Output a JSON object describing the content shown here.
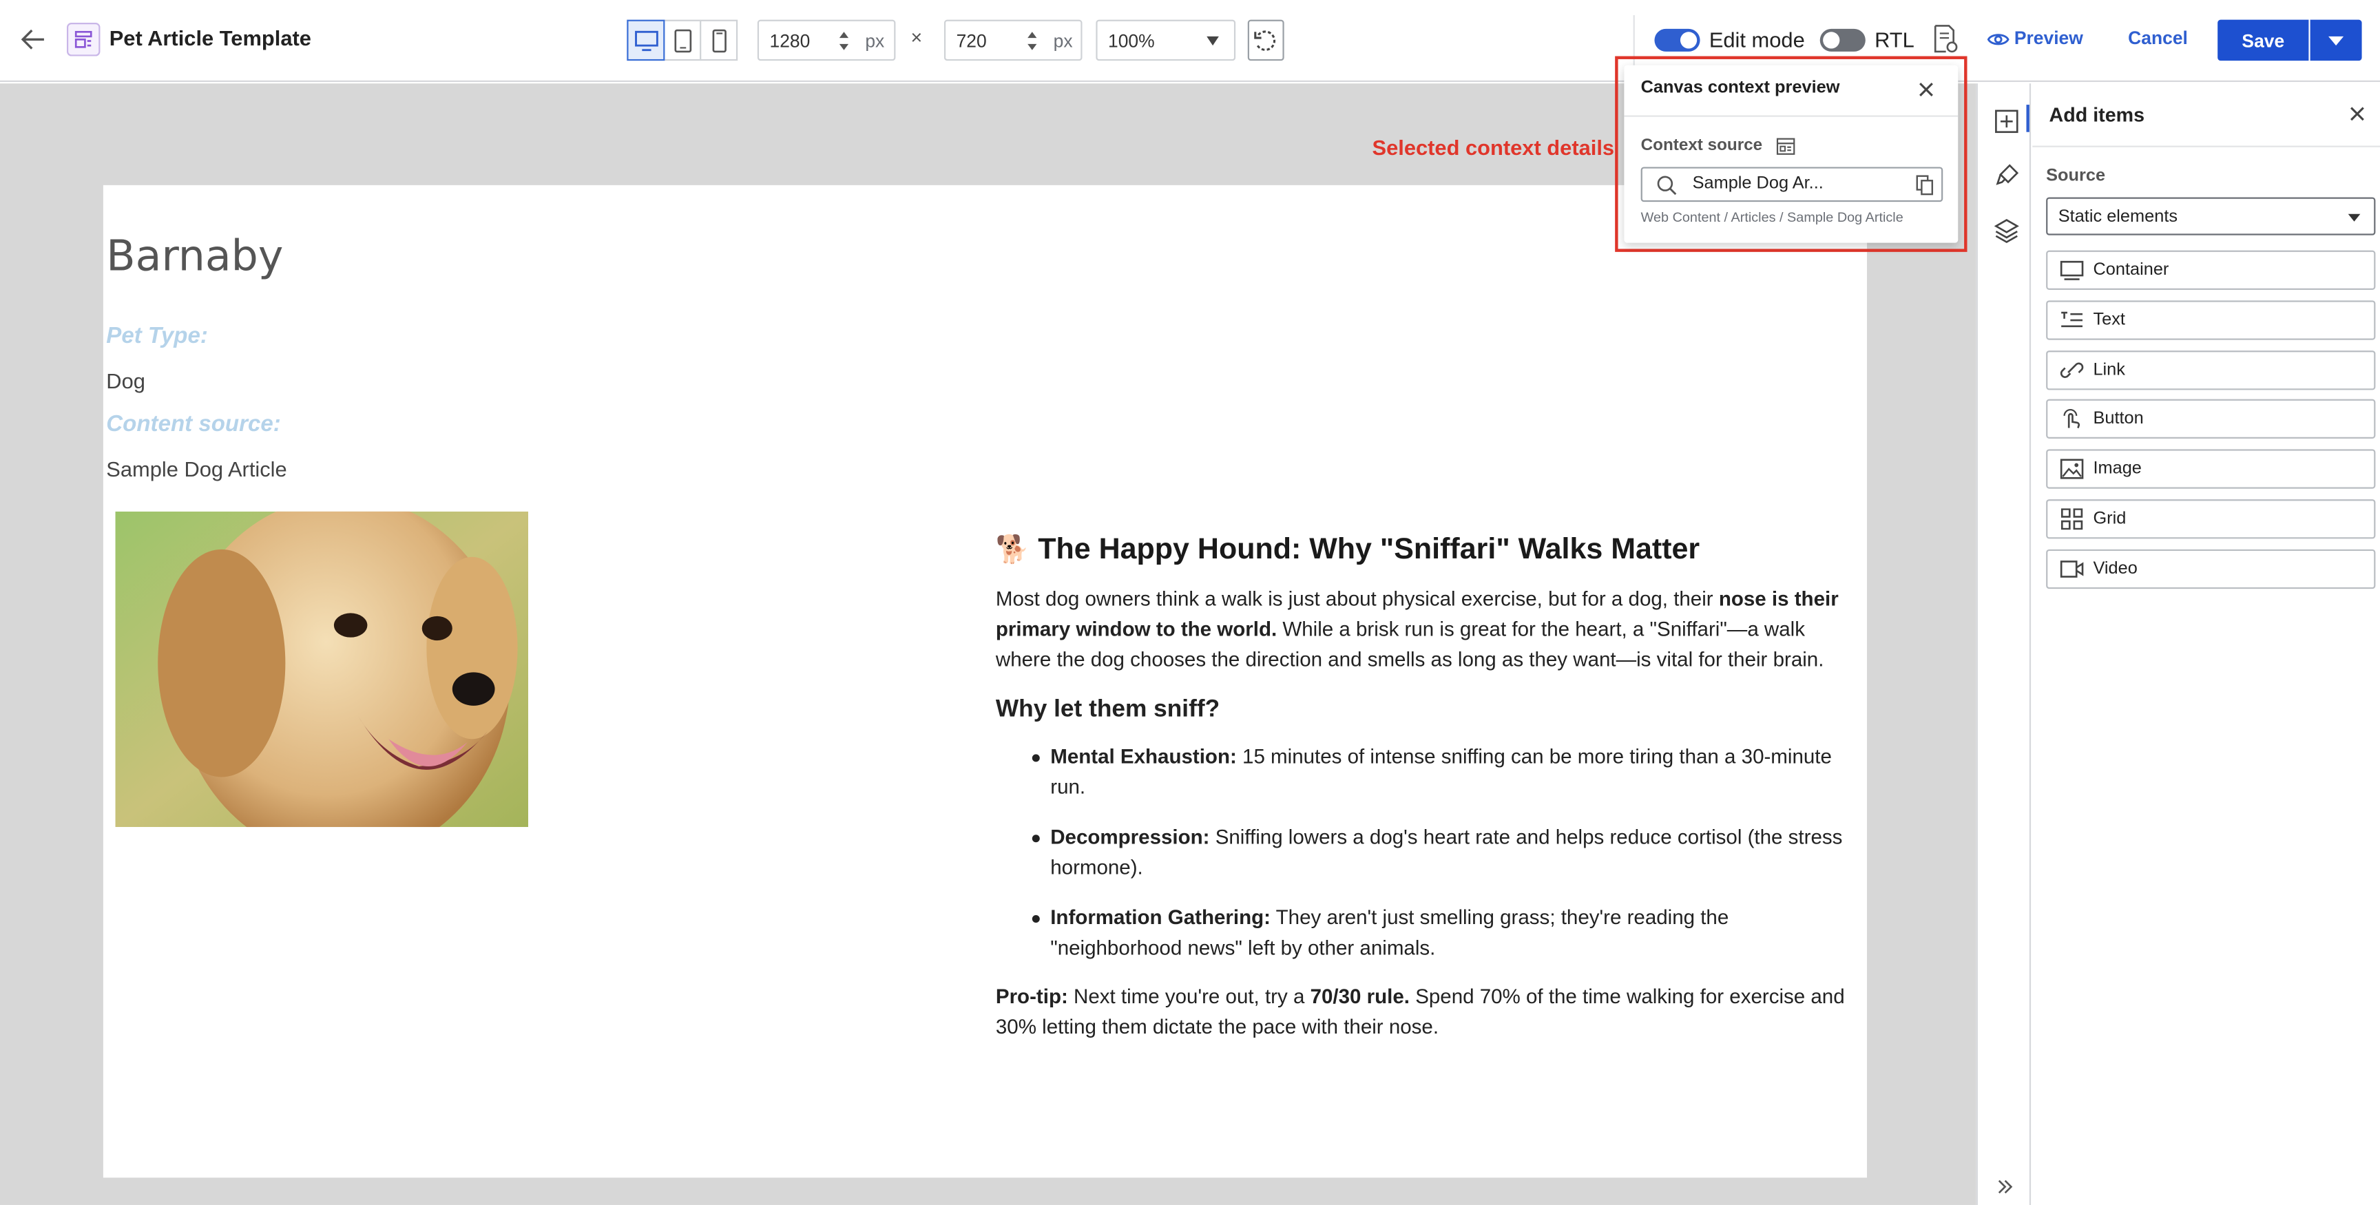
{
  "header": {
    "title": "Pet Article Template",
    "width_value": "1280",
    "height_value": "720",
    "unit": "px",
    "times": "×",
    "zoom": "100%",
    "edit_mode_label": "Edit mode",
    "edit_mode_on": true,
    "rtl_label": "RTL",
    "rtl_on": false,
    "preview_label": "Preview",
    "cancel_label": "Cancel",
    "save_label": "Save"
  },
  "canvas": {
    "context_details_label": "Selected context details",
    "pet_name": "Barnaby",
    "pet_type_label": "Pet Type:",
    "pet_type_value": "Dog",
    "content_source_label": "Content source:",
    "content_source_value": "Sample Dog Article",
    "article": {
      "emoji": "🐕",
      "heading": "The Happy Hound: Why \"Sniffari\" Walks Matter",
      "intro_a": "Most dog owners think a walk is just about physical exercise, but for a dog, their ",
      "intro_bold": "nose is their primary window to the world.",
      "intro_b": " While a brisk run is great for the heart, a \"Sniffari\"—a walk where the dog chooses the direction and smells as long as they want—is vital for their brain.",
      "subheading": "Why let them sniff?",
      "bullets": [
        {
          "bold": "Mental Exhaustion:",
          "text": " 15 minutes of intense sniffing can be more tiring than a 30-minute run."
        },
        {
          "bold": "Decompression:",
          "text": " Sniffing lowers a dog's heart rate and helps reduce cortisol (the stress hormone)."
        },
        {
          "bold": "Information Gathering:",
          "text": " They aren't just smelling grass; they're reading the \"neighborhood news\" left by other animals."
        }
      ],
      "tip_bold": "Pro-tip:",
      "tip_a": " Next time you're out, try a ",
      "tip_rule": "70/30 rule.",
      "tip_b": " Spend 70% of the time walking for exercise and 30% letting them dictate the pace with their nose."
    }
  },
  "context_popup": {
    "title": "Canvas context preview",
    "source_label": "Context source",
    "source_value": "Sample Dog Ar...",
    "path": "Web Content / Articles / Sample Dog Article"
  },
  "add_items": {
    "title": "Add items",
    "source_label": "Source",
    "source_value": "Static elements",
    "items": [
      {
        "label": "Container",
        "icon": "container-icon"
      },
      {
        "label": "Text",
        "icon": "text-icon"
      },
      {
        "label": "Link",
        "icon": "link-icon"
      },
      {
        "label": "Button",
        "icon": "button-icon"
      },
      {
        "label": "Image",
        "icon": "image-icon"
      },
      {
        "label": "Grid",
        "icon": "grid-icon"
      },
      {
        "label": "Video",
        "icon": "video-icon"
      }
    ]
  },
  "colors": {
    "accent": "#1d50d0",
    "highlight": "#e0362b",
    "field_label": "#b5d3ea"
  }
}
